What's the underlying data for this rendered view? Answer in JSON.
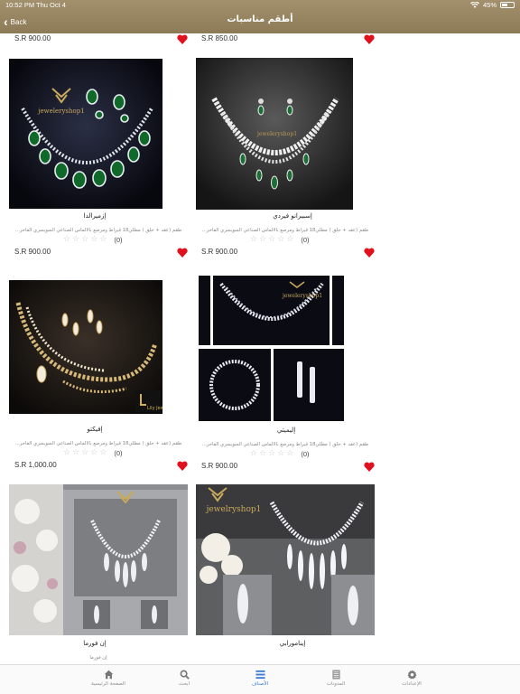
{
  "status_bar": {
    "time": "10:52 PM",
    "date": "Thu Oct 4",
    "battery": "45%"
  },
  "header": {
    "back_label": "Back",
    "title": "أطقم مناسبات"
  },
  "top_prices": {
    "left": "S.R 900.00",
    "right": "S.R 850.00"
  },
  "products": [
    {
      "name": "إزميرالدا",
      "desc": "طقم (عقد + حلق ) مطلي18 قيراط ومرصع بالألماس الصناعي السويسري الفاخر...",
      "rating_count": "(0)",
      "price": "S.R 900.00",
      "image": "emerald-necklace"
    },
    {
      "name": "إسبيرانو فيردي",
      "desc": "طقم (عقد + حلق ) مطلي18 قيراط ومرصع بالألماس الصناعي السويسري الفاخر...",
      "rating_count": "(0)",
      "price": "S.R 900.00",
      "image": "diamond-emerald-drops"
    },
    {
      "name": "إفيكتو",
      "desc": "طقم (عقد + حلق ) مطلي18 قيراط ومرصع بالألماس الصناعي السويسري الفاخر...",
      "rating_count": "(0)",
      "price": "S.R 1,000.00",
      "image": "gold-diamond-set"
    },
    {
      "name": "إليميتي",
      "desc": "طقم (عقد + حلق ) مطلي18 قيراط ومرصع بالألماس الصناعي السويسري الفاخر...",
      "rating_count": "(0)",
      "price": "S.R 900.00",
      "image": "collage-set"
    },
    {
      "name": "إن فورما",
      "desc": "إن فورما",
      "rating_count": "",
      "price": "",
      "image": "display-set"
    },
    {
      "name": "إينامورابي",
      "desc": "",
      "rating_count": "",
      "price": "",
      "image": "cascade-set"
    }
  ],
  "tabs": [
    {
      "label": "الإعدادات",
      "icon": "gear-icon"
    },
    {
      "label": "المدونات",
      "icon": "blog-icon"
    },
    {
      "label": "الأصناف",
      "icon": "menu-icon",
      "active": true
    },
    {
      "label": "ابحث",
      "icon": "search-icon"
    },
    {
      "label": "الصفحة الرئيسية",
      "icon": "home-icon"
    }
  ],
  "colors": {
    "header": "#9b8865",
    "heart": "#e0101d",
    "active_tab": "#3a7bd5"
  }
}
